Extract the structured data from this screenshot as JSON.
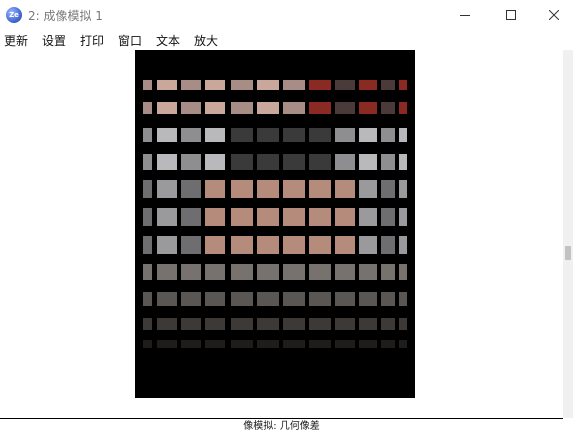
{
  "window": {
    "title": "2: 成像模拟 1",
    "icon": "zemax-app-icon",
    "icon_text": "Ze"
  },
  "menu": {
    "items": [
      {
        "label": "更新"
      },
      {
        "label": "设置"
      },
      {
        "label": "打印"
      },
      {
        "label": "窗口"
      },
      {
        "label": "文本"
      },
      {
        "label": "放大"
      }
    ]
  },
  "status": {
    "text": "像模拟: 几何像差"
  },
  "colors": {
    "image_background": "#000000",
    "skin": "#b58b7b",
    "grey": "#b9b9bb",
    "red": "#8a2a22"
  }
}
